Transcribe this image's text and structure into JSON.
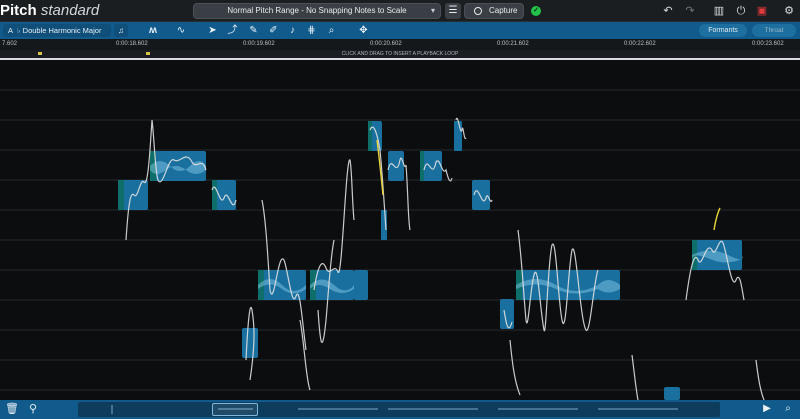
{
  "app": {
    "name": "Pitch",
    "edition": "standard"
  },
  "titlebar": {
    "pitch_range": "Normal Pitch Range - No Snapping Notes to Scale",
    "capture_label": "Capture"
  },
  "toolbar": {
    "key_note": "A",
    "key_accidental": "♭",
    "key_scale": "Double Harmonic Major",
    "formants_label": "Formants",
    "extra_label": "Throat"
  },
  "ruler": {
    "ticks": [
      "7.602",
      "0:00:18.602",
      "0:00:19.602",
      "0:00:20.602",
      "0:00:21.602",
      "0:00:22.602",
      "0:00:23.602"
    ]
  },
  "loopbar": {
    "hint": "CLICK AND DRAG TO INSERT A PLAYBACK LOOP"
  },
  "colors": {
    "toolbar_blue": "#115b8c",
    "note_blue": "#1c83b8",
    "note_edge": "#0e6f6a",
    "pitch_curve": "#e0e0e0",
    "pitch_highlight": "#e8d23a",
    "status_green": "#23c24a"
  },
  "icons": {
    "logo": "pitch-logo",
    "undo": "undo-icon",
    "redo": "redo-icon",
    "record": "record-icon"
  }
}
